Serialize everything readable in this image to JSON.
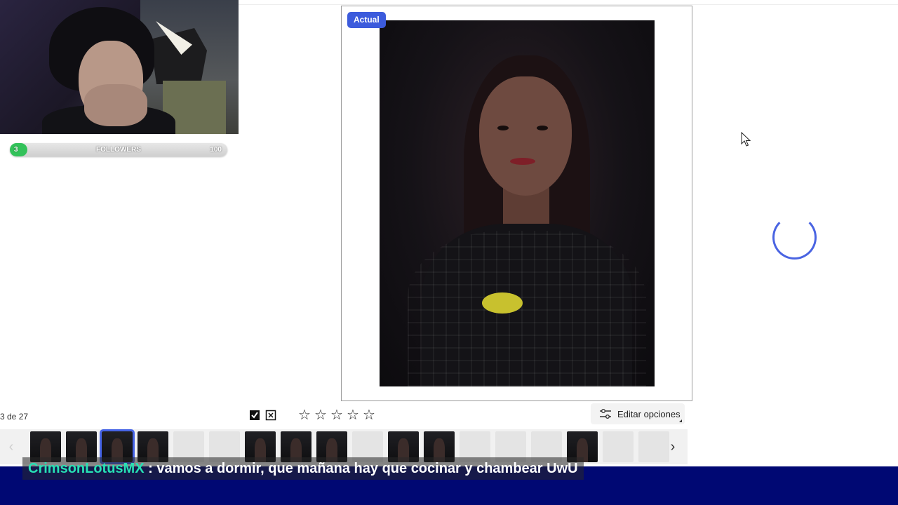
{
  "webcam": {
    "followers_current": "3",
    "followers_label": "FOLLOWERS",
    "followers_goal": "100",
    "followers_progress": 0.03
  },
  "viewer": {
    "badge": "Actual"
  },
  "toolbar": {
    "counter": "3 de 27",
    "edit_label": "Editar opciones",
    "stars_total": 5,
    "stars_selected": 0
  },
  "filmstrip": {
    "selected_index": 2,
    "thumbnails": [
      "dark",
      "dark",
      "dark",
      "dark",
      "faded",
      "faded",
      "dark",
      "dark",
      "dark",
      "faded",
      "dark",
      "dark",
      "faded",
      "faded",
      "faded",
      "dark",
      "faded",
      "faded"
    ]
  },
  "chat": {
    "username": "CrimsonLotusMX",
    "separator": " : ",
    "message": "vamos a dormir, que mañana hay que cocinar y chambear UwU"
  },
  "colors": {
    "accent": "#3c5bdc",
    "chat_bar": "#000873",
    "chat_user": "#27e2b5",
    "followers_fill": "#33c25a"
  },
  "icons": [
    "flag-check-icon",
    "flag-reject-icon",
    "star-icon",
    "sliders-icon",
    "chevron-left-icon",
    "chevron-right-icon",
    "cursor-icon",
    "loading-spinner-icon"
  ]
}
